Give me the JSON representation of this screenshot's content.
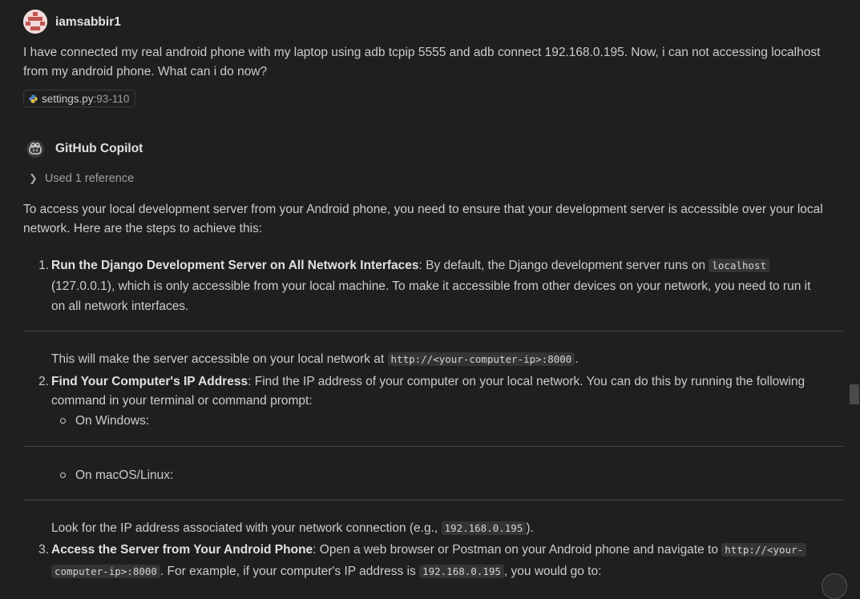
{
  "user": {
    "name": "iamsabbir1",
    "message": "I have connected my real android phone with my laptop using adb tcpip 5555 and adb connect 192.168.0.195. Now, i can not accessing localhost from my android phone. What can i do now?",
    "attachment": {
      "file": "settings.py",
      "range": ":93-110"
    }
  },
  "assistant": {
    "name": "GitHub Copilot",
    "references_label": "Used 1 reference",
    "intro": "To access your local development server from your Android phone, you need to ensure that your development server is accessible over your local network. Here are the steps to achieve this:",
    "steps": [
      {
        "number": "1.",
        "title": "Run the Django Development Server on All Network Interfaces",
        "text_before": ": By default, the Django development server runs on ",
        "code": "localhost",
        "line2": "(127.0.0.1), which is only accessible from your local machine. To make it accessible from other devices on your network, you need to run it",
        "line3": "on all network interfaces.",
        "after_before": "This will make the server accessible on your local network at ",
        "after_code": "http://<your-computer-ip>:8000",
        "after_end": "."
      },
      {
        "number": "2.",
        "title": "Find Your Computer's IP Address",
        "text": ": Find the IP address of your computer on your local network. You can do this by running the following",
        "line2": "command in your terminal or command prompt:",
        "sub": [
          "On Windows:",
          "On macOS/Linux:"
        ],
        "after_before": "Look for the IP address associated with your network connection (e.g., ",
        "after_code": "192.168.0.195",
        "after_end": ")."
      },
      {
        "number": "3.",
        "title": "Access the Server from Your Android Phone",
        "text": ": Open a web browser or Postman on your Android phone and navigate to ",
        "code_a": "http://<your-",
        "code_b": "computer-ip>:8000",
        "mid": ". For example, if your computer's IP address is ",
        "code_ip": "192.168.0.195",
        "end": ", you would go to:"
      }
    ]
  }
}
